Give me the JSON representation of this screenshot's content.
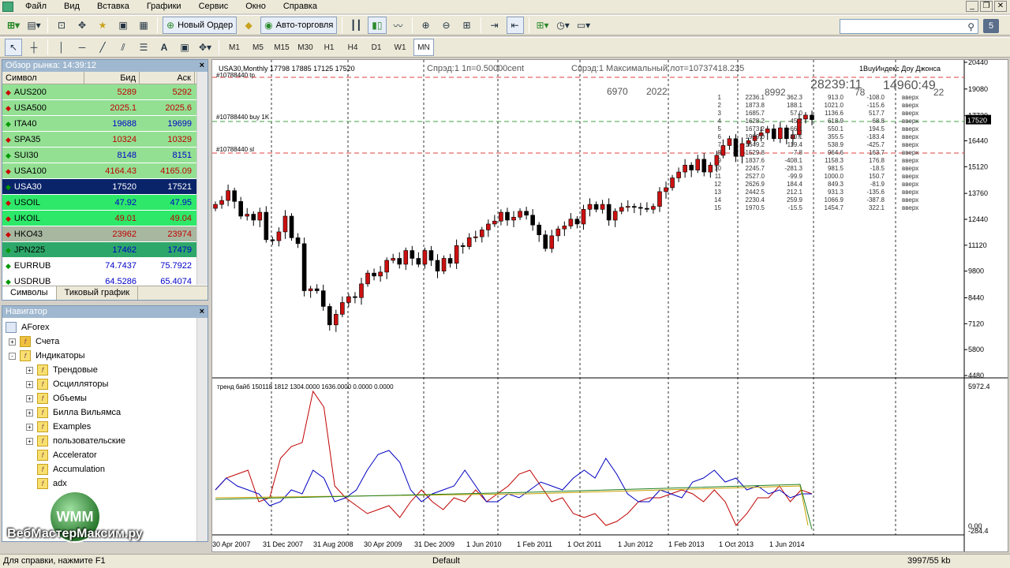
{
  "menu": [
    "Файл",
    "Вид",
    "Вставка",
    "Графики",
    "Сервис",
    "Окно",
    "Справка"
  ],
  "toolbar": {
    "new_order": "Новый Ордер",
    "auto_trading": "Авто-торговля",
    "timeframes": [
      "M1",
      "M5",
      "M15",
      "M30",
      "H1",
      "H4",
      "D1",
      "W1",
      "MN"
    ],
    "active_timeframe": "MN",
    "search_counter": "5"
  },
  "market_watch": {
    "title": "Обзор рынка: 14:39:12",
    "columns": [
      "Символ",
      "Бид",
      "Аск"
    ],
    "rows": [
      {
        "symbol": "AUS200",
        "bid": "5289",
        "ask": "5292",
        "dir": "down",
        "bg": "#93e093",
        "color": "#c00000"
      },
      {
        "symbol": "USA500",
        "bid": "2025.1",
        "ask": "2025.6",
        "dir": "down",
        "bg": "#93e093",
        "color": "#c00000"
      },
      {
        "symbol": "ITA40",
        "bid": "19688",
        "ask": "19699",
        "dir": "up",
        "bg": "#93e093",
        "color": "#0000c8"
      },
      {
        "symbol": "SPA35",
        "bid": "10324",
        "ask": "10329",
        "dir": "down",
        "bg": "#93e093",
        "color": "#c00000"
      },
      {
        "symbol": "SUI30",
        "bid": "8148",
        "ask": "8151",
        "dir": "up",
        "bg": "#93e093",
        "color": "#0000c8"
      },
      {
        "symbol": "USA100",
        "bid": "4164.43",
        "ask": "4165.09",
        "dir": "down",
        "bg": "#93e093",
        "color": "#c00000"
      },
      {
        "symbol": "USA30",
        "bid": "17520",
        "ask": "17521",
        "dir": "up",
        "bg": "#0a246a",
        "color": "#ffffff"
      },
      {
        "symbol": "USOIL",
        "bid": "47.92",
        "ask": "47.95",
        "dir": "down",
        "bg": "#2ee86a",
        "color": "#0000c8"
      },
      {
        "symbol": "UKOIL",
        "bid": "49.01",
        "ask": "49.04",
        "dir": "down",
        "bg": "#2ee86a",
        "color": "#c00000"
      },
      {
        "symbol": "HKO43",
        "bid": "23962",
        "ask": "23974",
        "dir": "down",
        "bg": "#a8b8a0",
        "color": "#c00000"
      },
      {
        "symbol": "JPN225",
        "bid": "17462",
        "ask": "17479",
        "dir": "up",
        "bg": "#2ea86a",
        "color": "#0000c8"
      },
      {
        "symbol": "EURRUB",
        "bid": "74.7437",
        "ask": "75.7922",
        "dir": "up",
        "bg": "#ffffff",
        "color": "#0000c8"
      },
      {
        "symbol": "USDRUB",
        "bid": "64.5286",
        "ask": "65.4074",
        "dir": "up",
        "bg": "#ffffff",
        "color": "#0000c8"
      }
    ],
    "tabs": [
      "Символы",
      "Тиковый график"
    ]
  },
  "navigator": {
    "title": "Навигатор",
    "root": "AForex",
    "items": [
      {
        "label": "Счета",
        "level": 1,
        "expander": "+",
        "icon": "accounts-icon"
      },
      {
        "label": "Индикаторы",
        "level": 1,
        "expander": "-",
        "icon": "folder-icon"
      },
      {
        "label": "Трендовые",
        "level": 2,
        "expander": "+",
        "icon": "indicator-icon"
      },
      {
        "label": "Осцилляторы",
        "level": 2,
        "expander": "+",
        "icon": "indicator-icon"
      },
      {
        "label": "Объемы",
        "level": 2,
        "expander": "+",
        "icon": "indicator-icon"
      },
      {
        "label": "Билла Вильямса",
        "level": 2,
        "expander": "+",
        "icon": "indicator-icon"
      },
      {
        "label": "Examples",
        "level": 2,
        "expander": "+",
        "icon": "indicator-icon"
      },
      {
        "label": "пользовательские",
        "level": 2,
        "expander": "+",
        "icon": "indicator-icon"
      },
      {
        "label": "Accelerator",
        "level": 2,
        "expander": "",
        "icon": "indicator-icon"
      },
      {
        "label": "Accumulation",
        "level": 2,
        "expander": "",
        "icon": "indicator-icon"
      },
      {
        "label": "adx",
        "level": 2,
        "expander": "",
        "icon": "indicator-icon"
      }
    ]
  },
  "chart": {
    "header": "USA30,Monthly  17798 17885 17125 17520",
    "spread_info": "Спрэд:1   1п=0.50000cent",
    "spread_info2": "Спрэд:1   Максимальный лот=10737418.235",
    "top_right_label": "1BuyИндекс Доу Джонса",
    "order_buy": "#10788440 buy 1K",
    "order_sl": "#10788440 sl",
    "order_tp": "#10788440 tp",
    "current_price": "17520",
    "big_numbers": [
      "6970",
      "2022",
      "8992",
      "28239:11",
      "14960:49",
      "78",
      "22"
    ],
    "stats_table": [
      [
        "1",
        "2236.1",
        "362.3",
        "913.0",
        "-108.0",
        "вверх"
      ],
      [
        "2",
        "1873.8",
        "188.1",
        "1021.0",
        "-115.6",
        "вверх"
      ],
      [
        "3",
        "1685.7",
        "57.0",
        "1136.6",
        "517.7",
        "вверх"
      ],
      [
        "4",
        "1628.2",
        "-45.2",
        "618.9",
        "68.8",
        "вверх"
      ],
      [
        "5",
        "1673.2",
        "-66.1",
        "550.1",
        "194.5",
        "вверх"
      ],
      [
        "6",
        "1989.0",
        "40.1",
        "355.5",
        "-183.4",
        "вверх"
      ],
      [
        "7",
        "1649.2",
        "119.4",
        "538.9",
        "-425.7",
        "вверх"
      ],
      [
        "8",
        "1529.8",
        "-7.8",
        "964.6",
        "163.7",
        "вверх"
      ],
      [
        "9",
        "1837.6",
        "-408.1",
        "1158.3",
        "176.8",
        "вверх"
      ],
      [
        "10",
        "2245.7",
        "-281.3",
        "981.5",
        "-18.5",
        "вверх"
      ],
      [
        "11",
        "2527.0",
        "-99.9",
        "1000.0",
        "150.7",
        "вверх"
      ],
      [
        "12",
        "2626.9",
        "184.4",
        "849.3",
        "-81.9",
        "вверх"
      ],
      [
        "13",
        "2442.5",
        "212.1",
        "931.3",
        "-135.6",
        "вверх"
      ],
      [
        "14",
        "2230.4",
        "259.9",
        "1066.9",
        "-387.8",
        "вверх"
      ],
      [
        "15",
        "1970.5",
        "-15.5",
        "1454.7",
        "322.1",
        "вверх"
      ]
    ],
    "price_axis": [
      "20440",
      "19080",
      "17720",
      "16440",
      "15120",
      "13760",
      "12440",
      "11120",
      "9800",
      "8440",
      "7120",
      "5800",
      "4480"
    ],
    "indicator_header": "тренд байб 150118 1812 1304.0000 1636.0000 0.0000 0.0000",
    "indicator_axis_top": "5972.4",
    "indicator_axis_bottom": "-284.4",
    "indicator_axis_bottom2": "0.00",
    "time_axis": [
      "30 Apr 2007",
      "31 Dec 2007",
      "31 Aug 2008",
      "30 Apr 2009",
      "31 Dec 2009",
      "1 Jun 2010",
      "1 Feb 2011",
      "1 Oct 2011",
      "1 Jun 2012",
      "1 Feb 2013",
      "1 Oct 2013",
      "1 Jun 2014"
    ]
  },
  "status": {
    "help": "Для справки, нажмите F1",
    "profile": "Default",
    "traffic": "3997/55 kb"
  },
  "watermark": {
    "circle": "WMM",
    "text": "ВебМастерМаксим.ру"
  }
}
